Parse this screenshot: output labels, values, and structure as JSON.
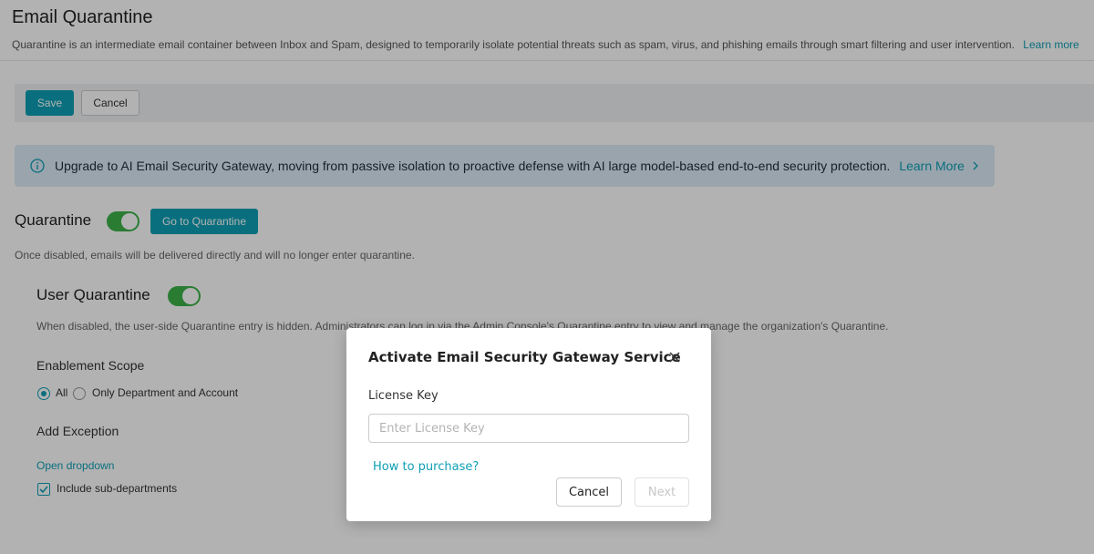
{
  "page": {
    "title": "Email Quarantine",
    "description": "Quarantine is an intermediate email container between Inbox and Spam, designed to temporarily isolate potential threats such as spam, virus, and phishing emails through smart filtering and user intervention.",
    "learn_more": "Learn more"
  },
  "toolbar": {
    "save_label": "Save",
    "cancel_label": "Cancel"
  },
  "banner": {
    "icon": "info-icon",
    "text": "Upgrade to AI Email Security Gateway, moving from passive isolation to proactive defense with AI large model-based end-to-end security protection.",
    "learn_more": "Learn More"
  },
  "quarantine": {
    "title": "Quarantine",
    "enabled": true,
    "go_button": "Go to Quarantine",
    "note": "Once disabled, emails will be delivered directly and will no longer enter quarantine."
  },
  "user_quarantine": {
    "title": "User Quarantine",
    "enabled": true,
    "note": "When disabled, the user-side Quarantine entry is hidden. Administrators can log in via the Admin Console's Quarantine entry to view and manage the organization's Quarantine.",
    "scope_label": "Enablement Scope",
    "scope_options": [
      "All",
      "Only Department and Account"
    ],
    "scope_selected": "All",
    "exception_label": "Add Exception",
    "dropdown_link": "Open dropdown",
    "include_sub_label": "Include sub-departments",
    "include_sub_checked": true
  },
  "modal": {
    "title": "Activate Email Security Gateway Service",
    "license_label": "License Key",
    "license_placeholder": "Enter License Key",
    "license_value": "",
    "purchase_link": "How to purchase?",
    "cancel_label": "Cancel",
    "next_label": "Next"
  },
  "colors": {
    "accent": "#0e9fb5",
    "toggle_on": "#3db24a",
    "banner_bg": "#dcebf7"
  }
}
